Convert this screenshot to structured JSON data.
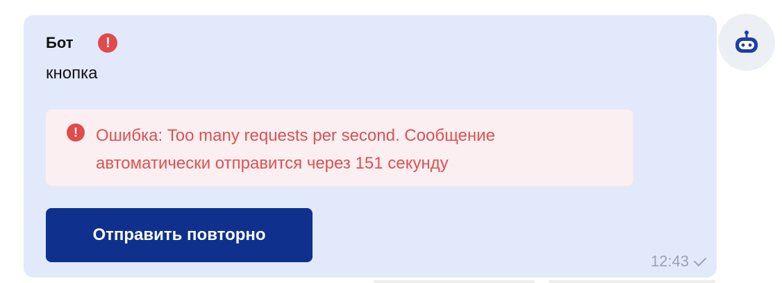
{
  "message": {
    "sender": "Бот",
    "text": "кнопка",
    "error_text": "Ошибка: Too many requests per second. Сообщение автоматически отправится через 151 секунду",
    "retry_label": "Отправить повторно",
    "time": "12:43"
  },
  "icons": {
    "status": "error-exclamation-icon",
    "error": "error-exclamation-icon",
    "delivered": "checkmark-icon",
    "avatar": "robot-icon"
  },
  "colors": {
    "bubble_bg": "#e1e9fb",
    "error_red": "#e14b4b",
    "error_bg": "#fbeff1",
    "button_bg": "#10308e",
    "meta_gray": "#9aa3b2"
  }
}
